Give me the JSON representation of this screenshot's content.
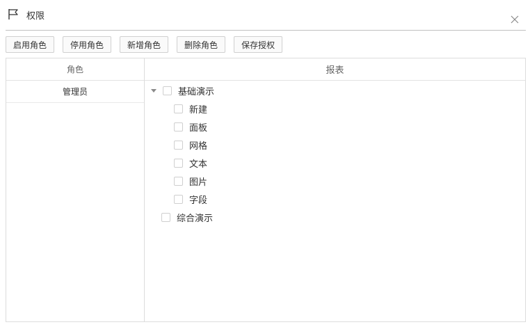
{
  "dialog": {
    "title": "权限",
    "icon": "flag-icon",
    "close_icon": "close-icon"
  },
  "toolbar": {
    "enable_role": "启用角色",
    "disable_role": "停用角色",
    "add_role": "新增角色",
    "delete_role": "删除角色",
    "save_permissions": "保存授权"
  },
  "roles_panel": {
    "header": "角色",
    "rows": [
      "管理员"
    ]
  },
  "reports_panel": {
    "header": "报表",
    "tree": [
      {
        "label": "基础演示",
        "checked": false,
        "expanded": true,
        "children": [
          {
            "label": "新建",
            "checked": false
          },
          {
            "label": "面板",
            "checked": false
          },
          {
            "label": "网格",
            "checked": false
          },
          {
            "label": "文本",
            "checked": false
          },
          {
            "label": "图片",
            "checked": false
          },
          {
            "label": "字段",
            "checked": false
          }
        ]
      },
      {
        "label": "综合演示",
        "checked": false,
        "expanded": false,
        "children": []
      }
    ]
  }
}
